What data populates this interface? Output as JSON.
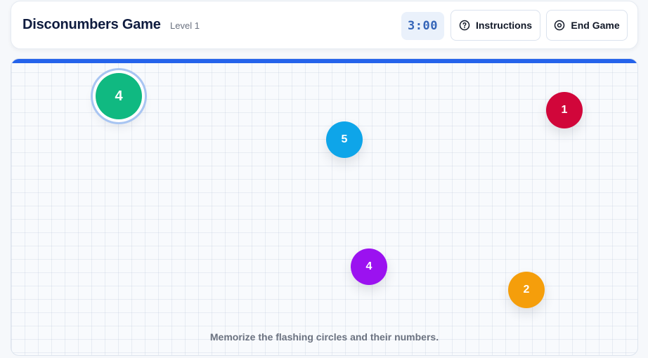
{
  "header": {
    "title": "Disconumbers Game",
    "level": "Level 1",
    "timer": "3:00",
    "instructions_label": "Instructions",
    "end_game_label": "End Game",
    "instructions_icon": "help-circle-icon",
    "end_game_icon": "stop-circle-icon"
  },
  "board": {
    "accent_color": "#2563eb",
    "circles": [
      {
        "number": "4",
        "color": "#10b981",
        "highlighted": true
      },
      {
        "number": "1",
        "color": "#d1063a",
        "highlighted": false
      },
      {
        "number": "5",
        "color": "#0ea5e9",
        "highlighted": false
      },
      {
        "number": "4",
        "color": "#9b12f0",
        "highlighted": false
      },
      {
        "number": "2",
        "color": "#f59e0b",
        "highlighted": false
      }
    ],
    "instruction": "Memorize the flashing circles and their numbers."
  }
}
